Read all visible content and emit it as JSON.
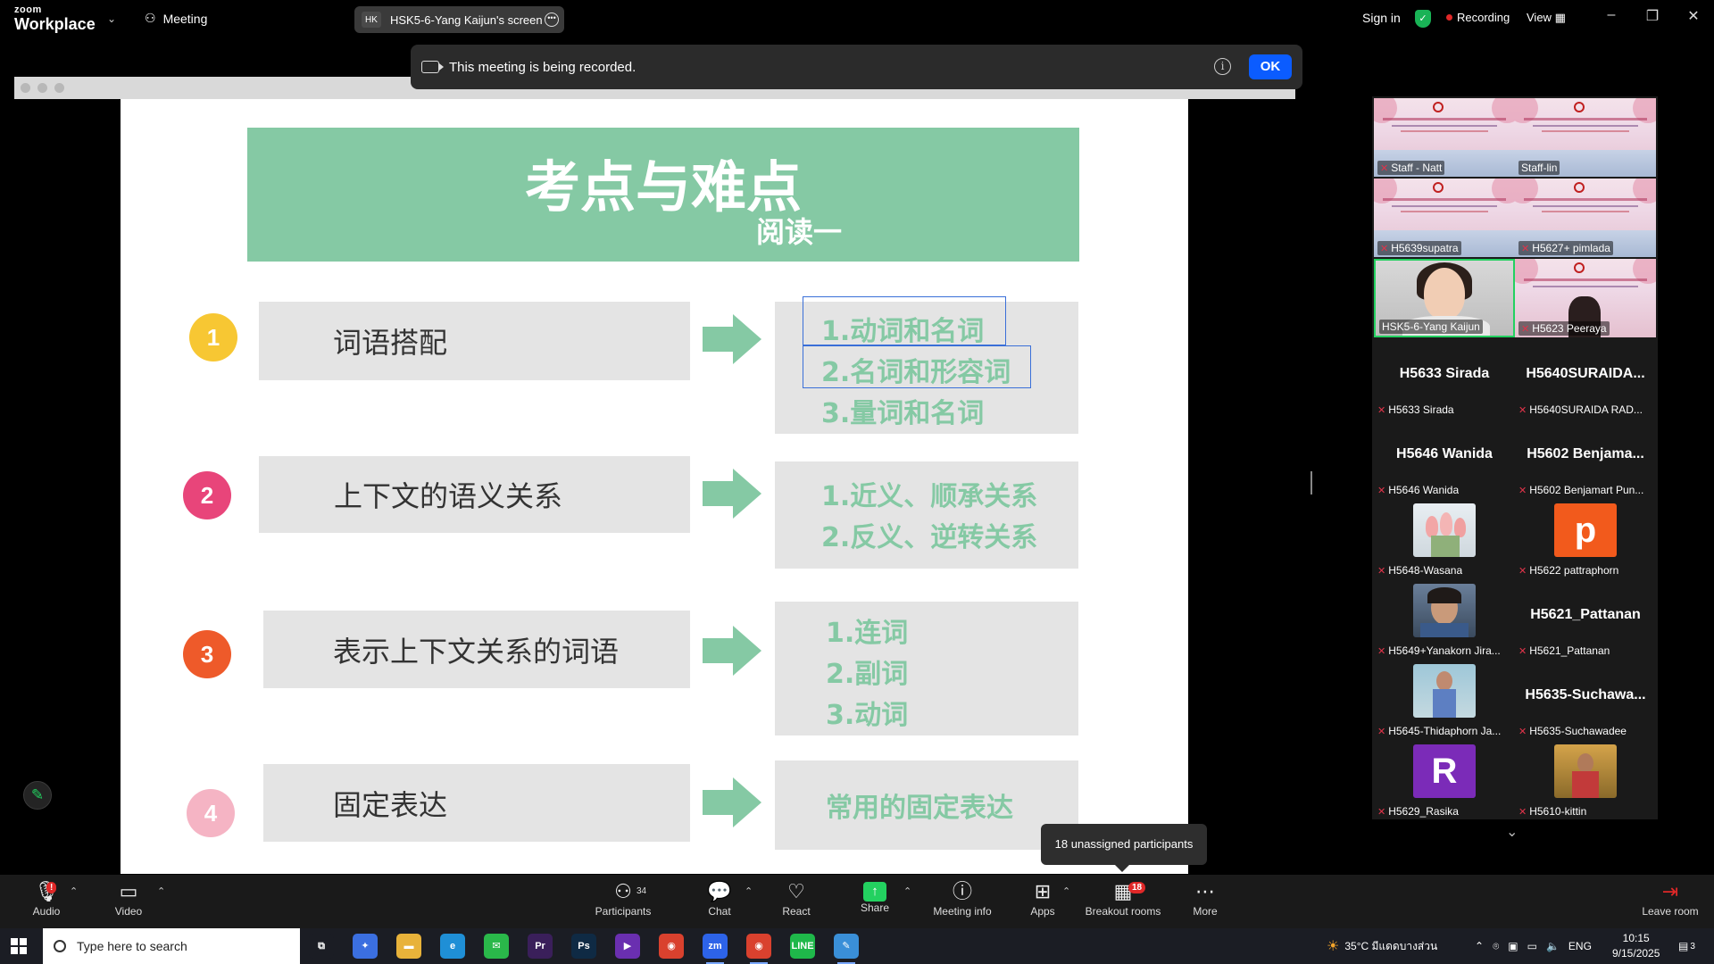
{
  "titlebar": {
    "logo_top": "zoom",
    "logo_bottom": "Workplace",
    "meeting_label": "Meeting",
    "screen_tab_initials": "HK",
    "screen_tab_label": "HSK5-6-Yang Kaijun's screen",
    "sign_in": "Sign in",
    "recording": "Recording",
    "view": "View",
    "minimize": "–",
    "restore": "❐",
    "close": "✕"
  },
  "notice": {
    "message": "This meeting is being recorded.",
    "info": "i",
    "ok": "OK"
  },
  "slide": {
    "title": "考点与难点",
    "subtitle": "阅读一",
    "rows": [
      {
        "num": "1",
        "color": "#f7c733",
        "label": "词语搭配",
        "items": [
          "1.动词和名词",
          "2.名词和形容词",
          "3.量词和名词"
        ]
      },
      {
        "num": "2",
        "color": "#e8457a",
        "label": "上下文的语义关系",
        "items": [
          "1.近义、顺承关系",
          "2.反义、逆转关系"
        ]
      },
      {
        "num": "3",
        "color": "#ee5a2a",
        "label": "表示上下文关系的词语",
        "items": [
          "1.连词",
          "2.副词",
          "3.动词"
        ]
      },
      {
        "num": "4",
        "color": "#f5b4c4",
        "label": "固定表达",
        "items": [
          "常用的固定表达"
        ]
      }
    ]
  },
  "gallery": {
    "video_tiles": [
      {
        "name": "Staff - Natt"
      },
      {
        "name": "Staff-lin"
      },
      {
        "name": "H5639supatra"
      },
      {
        "name": "H5627+ pimlada"
      },
      {
        "name": "HSK5-6-Yang Kaijun"
      },
      {
        "name": "H5623 Peeraya"
      }
    ],
    "name_tiles": [
      {
        "big": "H5633 Sirada",
        "label": "H5633 Sirada"
      },
      {
        "big": "H5640SURAIDA...",
        "label": "H5640SURAIDA  RAD..."
      },
      {
        "big": "H5646 Wanida",
        "label": "H5646 Wanida"
      },
      {
        "big": "H5602  Benjama...",
        "label": "H5602 Benjamart Pun..."
      }
    ],
    "avatar_tiles": [
      {
        "label": "H5648-Wasana",
        "kind": "tulip"
      },
      {
        "label": "H5622 pattraphorn",
        "kind": "letter",
        "letter": "p",
        "color": "#f25a1c"
      },
      {
        "label": "H5649+Yanakorn Jira...",
        "kind": "person"
      },
      {
        "label": "H5621_Pattanan",
        "kind": "name",
        "big": "H5621_Pattanan"
      },
      {
        "label": "H5645-Thidaphorn Ja...",
        "kind": "person2"
      },
      {
        "label": "H5635-Suchawadee",
        "kind": "name",
        "big": "H5635-Suchawa..."
      },
      {
        "label": "H5629_Rasika",
        "kind": "letter",
        "letter": "R",
        "color": "#7b2bb8"
      },
      {
        "label": "H5610-kittin",
        "kind": "field"
      }
    ],
    "scroll_more": "⌄"
  },
  "tooltip": "18 unassigned participants",
  "toolbar": {
    "audio": "Audio",
    "video": "Video",
    "participants": "Participants",
    "participants_count": "34",
    "chat": "Chat",
    "react": "React",
    "share": "Share",
    "meeting_info": "Meeting info",
    "apps": "Apps",
    "breakout": "Breakout rooms",
    "breakout_badge": "18",
    "more": "More",
    "leave": "Leave room",
    "audio_badge": "!"
  },
  "taskbar": {
    "search_placeholder": "Type here to search",
    "weather": "35°C  มีแดดบางส่วน",
    "lang": "ENG",
    "time": "10:15",
    "date": "9/15/2025",
    "notif_count": "3",
    "apps": [
      {
        "name": "task-view-app",
        "label": "⧉",
        "color": "#1b1d24"
      },
      {
        "name": "copilot-app",
        "label": "✦",
        "color": "#3b6fe0"
      },
      {
        "name": "file-explorer-app",
        "label": "▬",
        "color": "#e8b23a"
      },
      {
        "name": "edge-app",
        "label": "e",
        "color": "#1f8fd6"
      },
      {
        "name": "wechat-app",
        "label": "✉",
        "color": "#2ab84a"
      },
      {
        "name": "premiere-app",
        "label": "Pr",
        "color": "#3a1f5a"
      },
      {
        "name": "photoshop-app",
        "label": "Ps",
        "color": "#0f2a44"
      },
      {
        "name": "visual-studio-app",
        "label": "▶",
        "color": "#6a2fb0"
      },
      {
        "name": "chrome-app",
        "label": "◉",
        "color": "#d9412e"
      },
      {
        "name": "zoom-app",
        "label": "zm",
        "color": "#2d63e8"
      },
      {
        "name": "chrome-app-2",
        "label": "◉",
        "color": "#d9412e"
      },
      {
        "name": "line-app",
        "label": "LINE",
        "color": "#1fb84a"
      },
      {
        "name": "whiteboard-app",
        "label": "✎",
        "color": "#3a8fd8"
      }
    ]
  }
}
